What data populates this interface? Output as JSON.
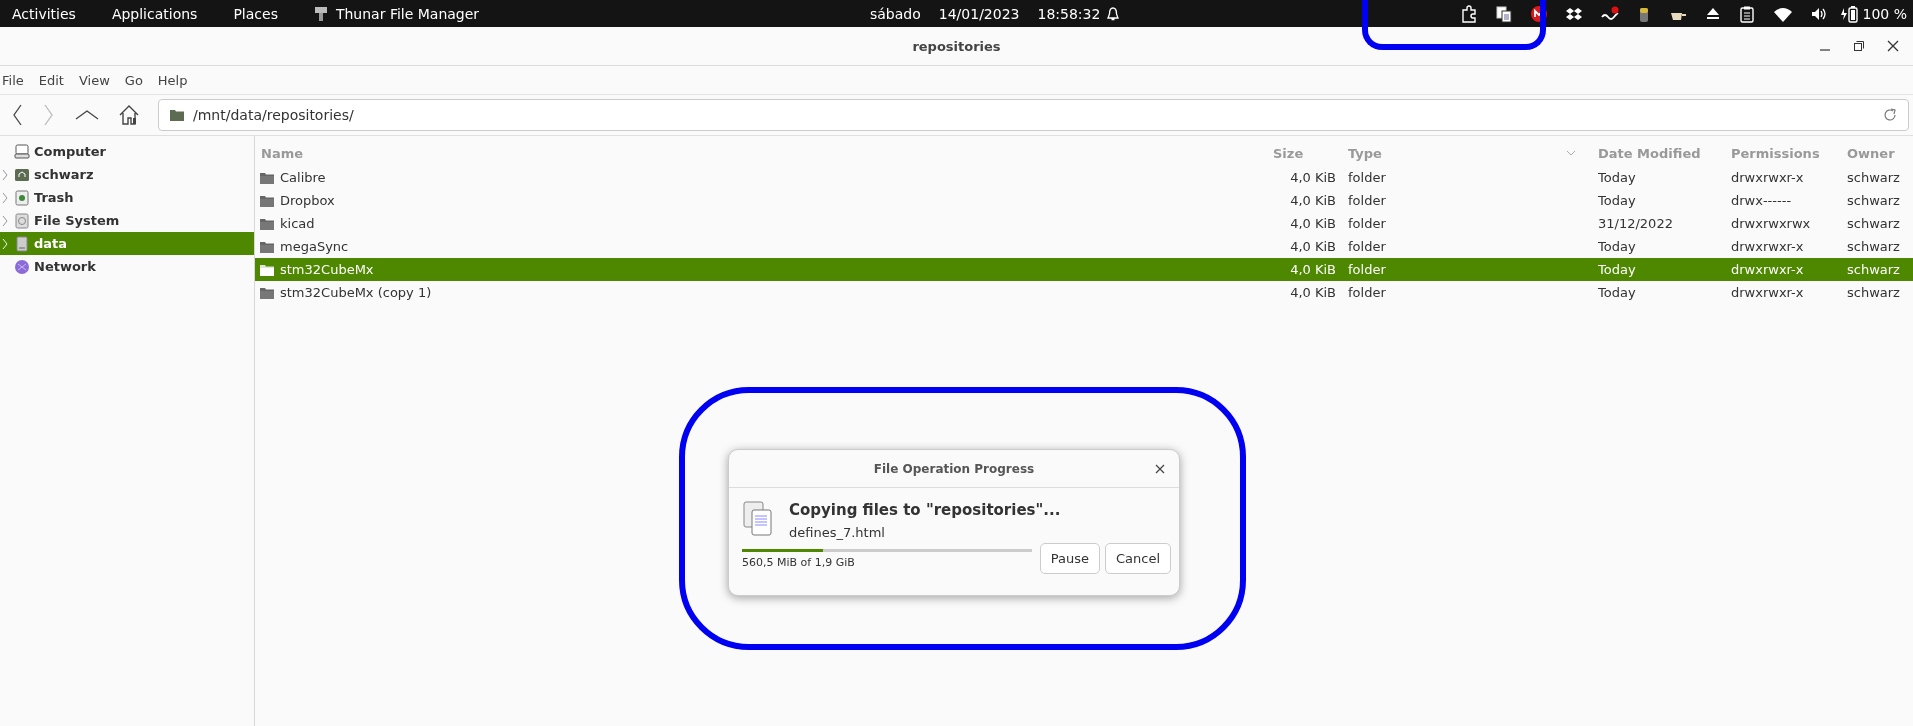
{
  "top_bar": {
    "menus": [
      {
        "label": "Activities"
      },
      {
        "label": "Applications"
      },
      {
        "label": "Places"
      }
    ],
    "app": {
      "label": "Thunar File Manager"
    },
    "clock": {
      "day": "sábado",
      "date": "14/01/2023",
      "time": "18:58:32"
    },
    "battery_text": "100 %",
    "tray_highlighted": true
  },
  "window": {
    "title": "repositories"
  },
  "menu": [
    "File",
    "Edit",
    "View",
    "Go",
    "Help"
  ],
  "location": {
    "path": "/mnt/data/repositories/"
  },
  "sidebar": {
    "items": [
      {
        "label": "Computer",
        "kind": "computer",
        "expander": false,
        "selected": false
      },
      {
        "label": "schwarz",
        "kind": "home",
        "expander": true,
        "selected": false
      },
      {
        "label": "Trash",
        "kind": "trash",
        "expander": true,
        "selected": false
      },
      {
        "label": "File System",
        "kind": "disk",
        "expander": true,
        "selected": false
      },
      {
        "label": "data",
        "kind": "drive",
        "expander": true,
        "selected": true
      },
      {
        "label": "Network",
        "kind": "network",
        "expander": false,
        "selected": false
      }
    ]
  },
  "table": {
    "columns": [
      "Name",
      "Size",
      "Type",
      "Date Modified",
      "Permissions",
      "Owner"
    ],
    "rows": [
      {
        "cells": [
          "Calibre",
          "4,0 KiB",
          "folder",
          "Today",
          "drwxrwxr-x",
          "schwarz"
        ],
        "selected": false
      },
      {
        "cells": [
          "Dropbox",
          "4,0 KiB",
          "folder",
          "Today",
          "drwx------",
          "schwarz"
        ],
        "selected": false
      },
      {
        "cells": [
          "kicad",
          "4,0 KiB",
          "folder",
          "31/12/2022",
          "drwxrwxrwx",
          "schwarz"
        ],
        "selected": false
      },
      {
        "cells": [
          "megaSync",
          "4,0 KiB",
          "folder",
          "Today",
          "drwxrwxr-x",
          "schwarz"
        ],
        "selected": false
      },
      {
        "cells": [
          "stm32CubeMx",
          "4,0 KiB",
          "folder",
          "Today",
          "drwxrwxr-x",
          "schwarz"
        ],
        "selected": true
      },
      {
        "cells": [
          "stm32CubeMx (copy 1)",
          "4,0 KiB",
          "folder",
          "Today",
          "drwxrwxr-x",
          "schwarz"
        ],
        "selected": false
      }
    ]
  },
  "dialog": {
    "title": "File Operation Progress",
    "heading": "Copying files to \"repositories\"...",
    "file": "defines_7.html",
    "progress": {
      "level": 0.28,
      "text": "560,5 MiB of 1,9 GiB"
    },
    "buttons": [
      "Pause",
      "Cancel"
    ],
    "highlighted": true
  }
}
